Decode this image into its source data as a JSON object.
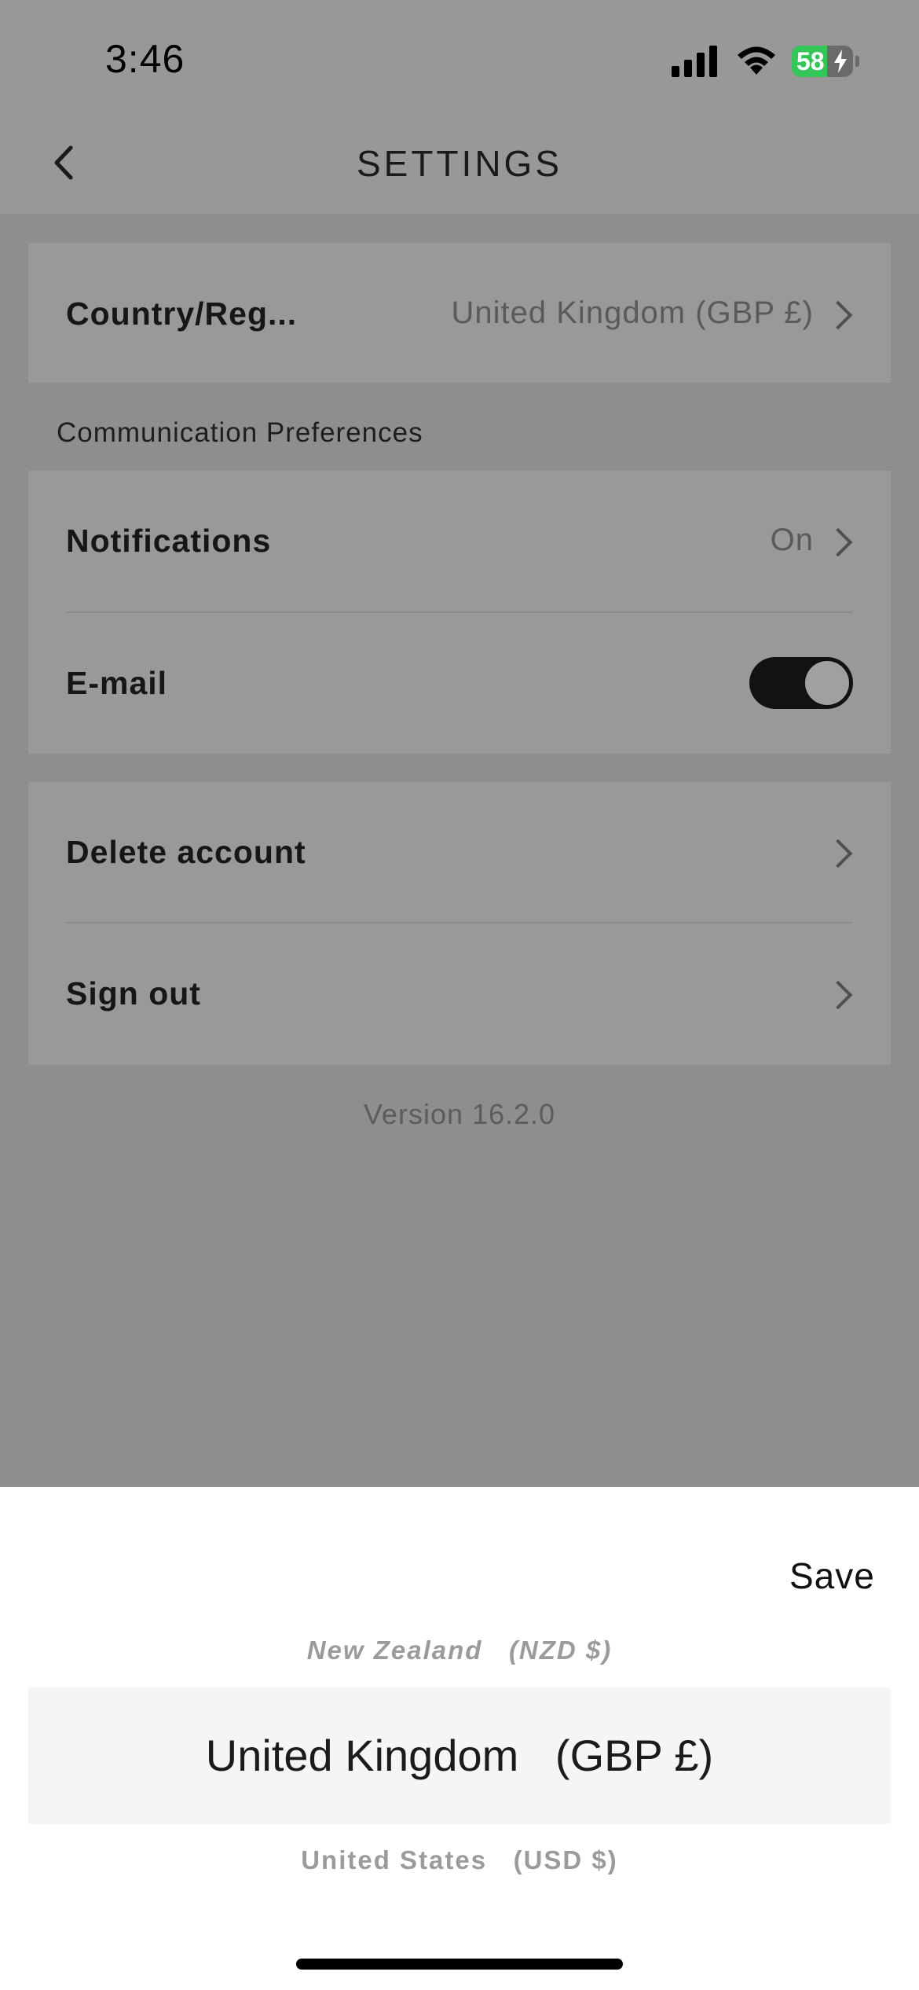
{
  "status_bar": {
    "time": "3:46",
    "battery_percent": 58,
    "battery_label": "58",
    "charging": true
  },
  "header": {
    "title": "SETTINGS"
  },
  "region": {
    "label": "Country/Reg...",
    "value": "United Kingdom (GBP £)"
  },
  "communication": {
    "heading": "Communication Preferences",
    "notifications": {
      "label": "Notifications",
      "value": "On"
    },
    "email": {
      "label": "E-mail",
      "enabled": true
    }
  },
  "account": {
    "delete_label": "Delete account",
    "signout_label": "Sign out"
  },
  "version": "Version 16.2.0",
  "picker": {
    "save_label": "Save",
    "options": [
      "New Zealand   (NZD $)",
      "United Kingdom   (GBP £)",
      "United States   (USD $)"
    ],
    "selected": "United Kingdom   (GBP £)"
  },
  "colors": {
    "battery_green": "#35c659",
    "toggle_on": "#121212",
    "selection_bg": "#f4f5f5"
  }
}
